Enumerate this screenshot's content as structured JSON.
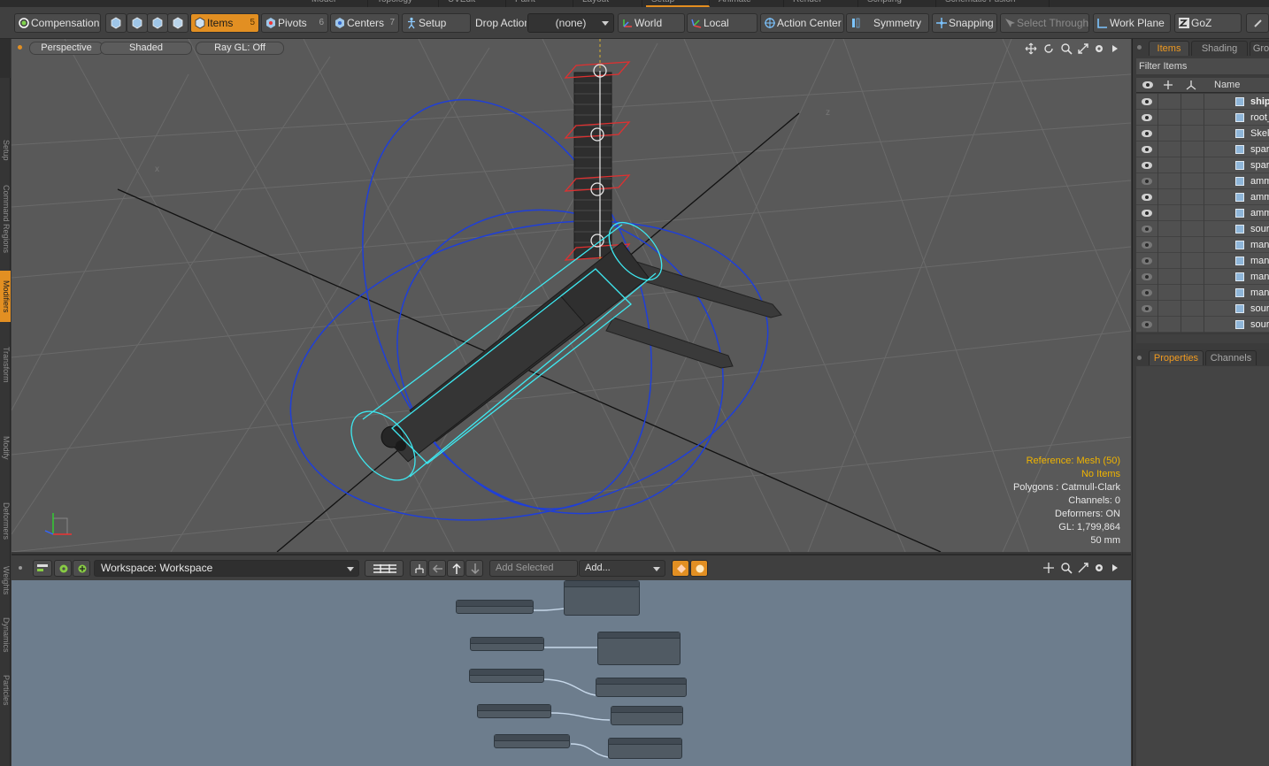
{
  "mode_tabs": [
    "Model",
    "Topology",
    "UVEdit",
    "Paint",
    "Layout",
    "Setup",
    "Animate",
    "Render",
    "Scripting",
    "Schematic Fusion"
  ],
  "toolbar": {
    "compensation_label": "Compensation",
    "items_label": "Items",
    "items_count": "5",
    "pivots_label": "Pivots",
    "pivots_count": "6",
    "centers_label": "Centers",
    "centers_count": "7",
    "setup_label": "Setup",
    "drop_action_label": "Drop Action",
    "drop_action_value": "(none)",
    "world_label": "World",
    "local_label": "Local",
    "action_center_label": "Action Center",
    "symmetry_label": "Symmetry",
    "snapping_label": "Snapping",
    "select_through_label": "Select Through",
    "work_plane_label": "Work Plane",
    "goz_label": "GoZ"
  },
  "left_tabs": [
    "Setup",
    "Command Regions",
    "Modifiers",
    "Transform",
    "Modify",
    "Deformers",
    "Weights",
    "Dynamics",
    "Particles"
  ],
  "viewport": {
    "view_mode": "Perspective",
    "shading_mode": "Shaded",
    "ray_gl": "Ray GL: Off",
    "hud": {
      "reference": "Reference: Mesh (50)",
      "selection": "No Items",
      "polygons": "Polygons : Catmull-Clark",
      "channels": "Channels: 0",
      "deformers": "Deformers: ON",
      "gl": "GL: 1,799,864",
      "units": "50 mm"
    }
  },
  "schematic": {
    "workspace_label": "Workspace: Workspace",
    "add_selected_placeholder": "Add Selected",
    "add_label": "Add..."
  },
  "right_panel": {
    "tabs": [
      "Items",
      "Shading",
      "Gro"
    ],
    "filter_placeholder": "Filter Items",
    "name_column": "Name",
    "items": [
      {
        "name": "shipCo",
        "visible": true
      },
      {
        "name": "root_",
        "visible": true
      },
      {
        "name": "Skele",
        "visible": true
      },
      {
        "name": "spar_",
        "visible": true
      },
      {
        "name": "spar_",
        "visible": true
      },
      {
        "name": "ammo",
        "visible": false
      },
      {
        "name": "ammo",
        "visible": true
      },
      {
        "name": "ammo",
        "visible": true
      },
      {
        "name": "sourc",
        "visible": false
      },
      {
        "name": "mane",
        "visible": false
      },
      {
        "name": "mane",
        "visible": false
      },
      {
        "name": "mane",
        "visible": false
      },
      {
        "name": "mane",
        "visible": false
      },
      {
        "name": "sourc",
        "visible": false
      },
      {
        "name": "sourc",
        "visible": false
      }
    ],
    "lower_tabs": [
      "Properties",
      "Channels"
    ]
  },
  "colors": {
    "accent": "#e28f22",
    "viewport_bg": "#595959",
    "schematic_bg": "#6d7d8d",
    "hud_highlight": "#f0b400",
    "selection_cyan": "#3ee8f0",
    "rotate_gizmo_blue": "#1f3fd8"
  }
}
